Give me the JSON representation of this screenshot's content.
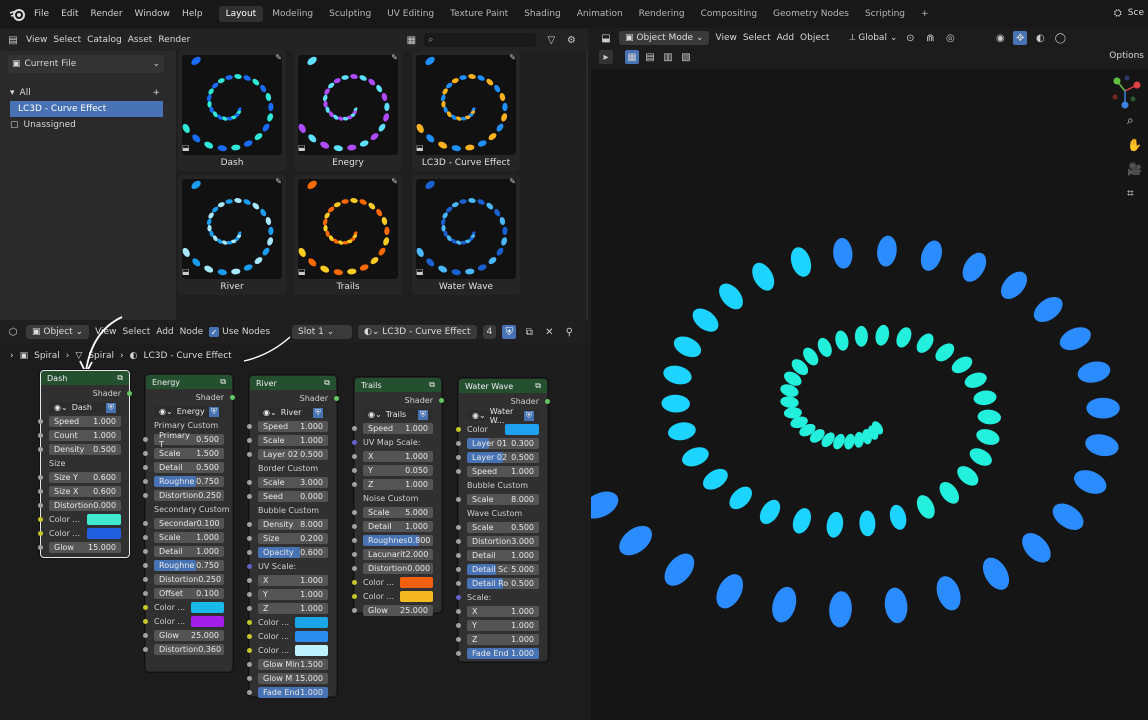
{
  "menu": [
    "File",
    "Edit",
    "Render",
    "Window",
    "Help"
  ],
  "workspaces": [
    "Layout",
    "Modeling",
    "Sculpting",
    "UV Editing",
    "Texture Paint",
    "Shading",
    "Animation",
    "Rendering",
    "Compositing",
    "Geometry Nodes",
    "Scripting"
  ],
  "active_workspace": "Layout",
  "scene_label": "Sce",
  "asset": {
    "header": [
      "View",
      "Select",
      "Catalog",
      "Asset",
      "Render"
    ],
    "library": "Current File",
    "catalog_all": "All",
    "catalog_selected": "LC3D - Curve Effect",
    "catalog_unassigned": "Unassigned",
    "items": [
      {
        "label": "Dash",
        "c1": "#2ee8d8",
        "c2": "#1a6cff"
      },
      {
        "label": "Enegry",
        "c1": "#b04cff",
        "c2": "#5ee0ff"
      },
      {
        "label": "LC3D - Curve Effect",
        "c1": "#ffb21e",
        "c2": "#1e90ff"
      },
      {
        "label": "River",
        "c1": "#a8e8ff",
        "c2": "#1a9cf0"
      },
      {
        "label": "Trails",
        "c1": "#ffcc22",
        "c2": "#ff6a00"
      },
      {
        "label": "Water Wave",
        "c1": "#4ab8ff",
        "c2": "#1a60d0"
      }
    ]
  },
  "node_header": {
    "object": "Object",
    "items": [
      "View",
      "Select",
      "Add",
      "Node"
    ],
    "use_nodes": "Use Nodes",
    "slot": "Slot 1",
    "material": "LC3D - Curve Effect",
    "users": "4"
  },
  "breadcrumb": [
    "Spiral",
    "Spiral",
    "LC3D - Curve Effect"
  ],
  "nodes": {
    "dash": {
      "title": "Dash",
      "out": "Shader",
      "group": "Dash",
      "rows": [
        [
          "Speed",
          "1.000"
        ],
        [
          "Count",
          "1.000"
        ],
        [
          "Density",
          "0.500"
        ]
      ],
      "sec": "Size",
      "rows2": [
        [
          "Size Y",
          "0.600"
        ],
        [
          "Size X",
          "0.600"
        ],
        [
          "Distortion",
          "0.000"
        ]
      ],
      "c1": "Color ...",
      "c2": "Color ...",
      "glow": [
        "Glow",
        "15.000"
      ],
      "col1": "#3fe8cf",
      "col2": "#1f5fe0"
    },
    "energy": {
      "title": "Energy",
      "out": "Shader",
      "group": "Energy",
      "sec1": "Primary Custom",
      "rows1": [
        [
          "Primary T",
          "0.500"
        ],
        [
          "Scale",
          "1.500"
        ],
        [
          "Detail",
          "0.500"
        ],
        [
          "Roughne",
          "0.750"
        ],
        [
          "Distortion",
          "0.250"
        ]
      ],
      "sec2": "Secondary Custom",
      "rows2": [
        [
          "Secondar",
          "0.100"
        ],
        [
          "Scale",
          "1.000"
        ],
        [
          "Detail",
          "1.000"
        ],
        [
          "Roughne",
          "0.750"
        ],
        [
          "Distortion",
          "0.250"
        ],
        [
          "Offset",
          "0.100"
        ]
      ],
      "c1": "Color ...",
      "c2": "Color ...",
      "glow": [
        "Glow",
        "25.000"
      ],
      "dist": [
        "Distortion",
        "0.360"
      ],
      "col1": "#19b9ea",
      "col2": "#a21ee8"
    },
    "river": {
      "title": "River",
      "out": "Shader",
      "group": "River",
      "rows1": [
        [
          "Speed",
          "1.000"
        ],
        [
          "Scale",
          "1.000"
        ],
        [
          "Layer 02",
          "0.500"
        ]
      ],
      "sec1": "Border Custom",
      "rows2": [
        [
          "Scale",
          "3.000"
        ],
        [
          "Seed",
          "0.000"
        ]
      ],
      "sec2": "Bubble Custom",
      "rows3": [
        [
          "Density",
          "8.000"
        ],
        [
          "Size",
          "0.200"
        ],
        [
          "Opacity",
          "0.600"
        ]
      ],
      "sec3": "UV Scale:",
      "rows4": [
        [
          "X",
          "1.000"
        ],
        [
          "Y",
          "1.000"
        ],
        [
          "Z",
          "1.000"
        ]
      ],
      "c1": "Color ...",
      "c2": "Color ...",
      "c3": "Color ...",
      "rows5": [
        [
          "Glow Min",
          "1.500"
        ],
        [
          "Glow M",
          "15.000"
        ],
        [
          "Fade End",
          "1.000"
        ]
      ],
      "col1": "#1aa6e6",
      "col2": "#2a8ef0",
      "col3": "#bff2ff"
    },
    "trails": {
      "title": "Trails",
      "out": "Shader",
      "group": "Trails",
      "rows1": [
        [
          "Speed",
          "1.000"
        ]
      ],
      "sec1": "UV Map Scale:",
      "rows2": [
        [
          "X",
          "1.000"
        ],
        [
          "Y",
          "0.050"
        ],
        [
          "Z",
          "1.000"
        ]
      ],
      "sec2": "Noise Custom",
      "rows3": [
        [
          "Scale",
          "5.000"
        ],
        [
          "Detail",
          "1.000"
        ],
        [
          "Roughnes",
          "0.800"
        ],
        [
          "Lacunarit",
          "2.000"
        ],
        [
          "Distortion",
          "0.000"
        ]
      ],
      "c1": "Color ...",
      "c2": "Color ...",
      "glow": [
        "Glow",
        "25.000"
      ],
      "col1": "#f06010",
      "col2": "#f5b820"
    },
    "water": {
      "title": "Water Wave",
      "out": "Shader",
      "group": "Water W...",
      "color": "Color",
      "rows1": [
        [
          "Layer 01",
          "0.300"
        ],
        [
          "Layer 02",
          "0.500"
        ],
        [
          "Speed",
          "1.000"
        ]
      ],
      "sec1": "Bubble Custom",
      "rows2": [
        [
          "Scale",
          "8.000"
        ]
      ],
      "sec2": "Wave Custom",
      "rows3": [
        [
          "Scale",
          "0.500"
        ],
        [
          "Distortion",
          "3.000"
        ],
        [
          "Detail",
          "1.000"
        ],
        [
          "Detail Sc",
          "5.000"
        ],
        [
          "Detail Ro",
          "0.500"
        ]
      ],
      "sec3": "Scale:",
      "rows4": [
        [
          "X",
          "1.000"
        ],
        [
          "Y",
          "1.000"
        ],
        [
          "Z",
          "1.000"
        ]
      ],
      "fade": [
        "Fade End",
        "1.000"
      ],
      "col1": "#1fa0f0"
    }
  },
  "viewport": {
    "mode": "Object Mode",
    "items": [
      "View",
      "Select",
      "Add",
      "Object"
    ],
    "orient": "Global",
    "options": "Options"
  }
}
